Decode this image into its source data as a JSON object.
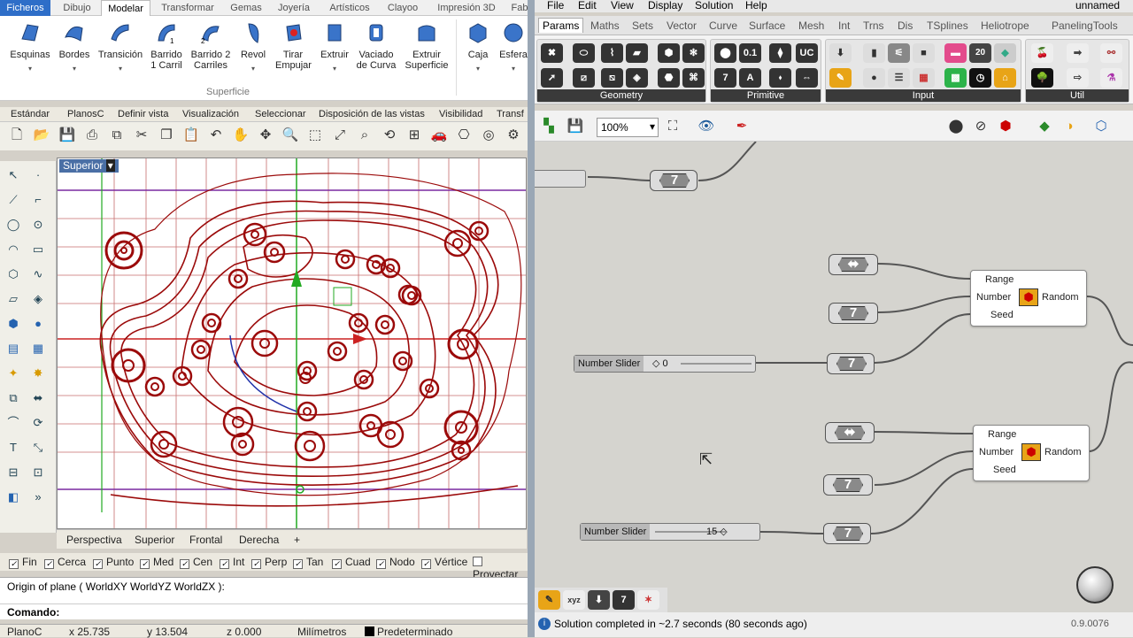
{
  "rhino": {
    "menu_tabs": [
      "Ficheros",
      "Dibujo",
      "Modelar",
      "Transformar",
      "Gemas",
      "Joyería",
      "Artísticos",
      "Clayoo",
      "Impresión 3D",
      "Fab"
    ],
    "active_menu_tab": "Modelar",
    "ribbon": {
      "buttons": [
        "Esquinas",
        "Bordes",
        "Transición",
        "Barrido 1 Carril",
        "Barrido 2 Carriles",
        "Revol",
        "Tirar Empujar",
        "Extruir",
        "Vaciado de Curva",
        "Extruir Superficie",
        "Caja",
        "Esfera"
      ],
      "group_label": "Superficie"
    },
    "toolbar_tabs": [
      "Estándar",
      "PlanosC",
      "Definir vista",
      "Visualización",
      "Seleccionar",
      "Disposición de las vistas",
      "Visibilidad",
      "Transf"
    ],
    "viewport_label": "Superior",
    "viewport_tabs": [
      "Perspectiva",
      "Superior",
      "Frontal",
      "Derecha",
      "+"
    ],
    "osnaps": [
      {
        "label": "Fin",
        "checked": true
      },
      {
        "label": "Cerca",
        "checked": true
      },
      {
        "label": "Punto",
        "checked": true
      },
      {
        "label": "Med",
        "checked": true
      },
      {
        "label": "Cen",
        "checked": true
      },
      {
        "label": "Int",
        "checked": true
      },
      {
        "label": "Perp",
        "checked": true
      },
      {
        "label": "Tan",
        "checked": true
      },
      {
        "label": "Cuad",
        "checked": true
      },
      {
        "label": "Nodo",
        "checked": true
      },
      {
        "label": "Vértice",
        "checked": true
      },
      {
        "label": "Proyectar",
        "checked": false
      }
    ],
    "command_history": "Origin of plane ( WorldXY  WorldYZ  WorldZX ):",
    "command_prompt": "Comando:",
    "status": {
      "cplane": "PlanoC",
      "x": "x 25.735",
      "y": "y 13.504",
      "z": "z 0.000",
      "units": "Milímetros",
      "layer": "Predeterminado"
    },
    "colors": {
      "curve": "#9b0a0a",
      "grid": "#b03030",
      "axis_x": "#cc2222",
      "axis_y": "#22aa22",
      "frame": "#7a2aa0"
    }
  },
  "grasshopper": {
    "menu": [
      "File",
      "Edit",
      "View",
      "Display",
      "Solution",
      "Help"
    ],
    "doc_name": "unnamed",
    "tabs": [
      "Params",
      "Maths",
      "Sets",
      "Vector",
      "Curve",
      "Surface",
      "Mesh",
      "Int",
      "Trns",
      "Dis",
      "TSplines",
      "Heliotrope",
      "PanelingTools"
    ],
    "active_tab": "Params",
    "groups": [
      "Geometry",
      "Primitive",
      "Input",
      "Util"
    ],
    "zoom": "100%",
    "components": [
      {
        "name": "Random",
        "inputs": [
          "Range",
          "Number",
          "Seed"
        ],
        "output": "Random"
      },
      {
        "name": "Random",
        "inputs": [
          "Range",
          "Number",
          "Seed"
        ],
        "output": "Random"
      }
    ],
    "sliders": [
      {
        "name": "Number Slider",
        "value": "0"
      },
      {
        "name": "Number Slider",
        "value": "15"
      }
    ],
    "status_message": "Solution completed in ~2.7 seconds (80 seconds ago)",
    "version": "0.9.0076"
  }
}
